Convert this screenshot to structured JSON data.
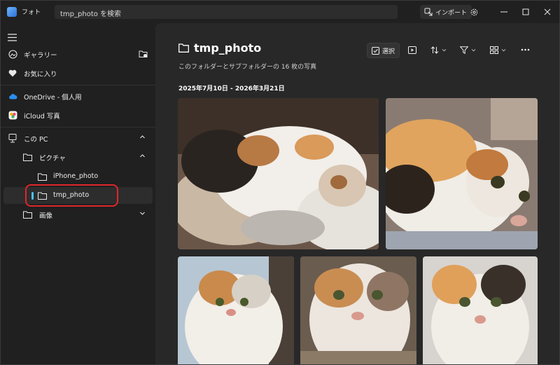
{
  "app": {
    "title": "フォト"
  },
  "search": {
    "value": "tmp_photo を検索"
  },
  "titlebar": {
    "import_label": "インポート"
  },
  "sidebar": {
    "gallery": "ギャラリー",
    "favorites": "お気に入り",
    "onedrive": "OneDrive - 個人用",
    "icloud": "iCloud 写真",
    "this_pc": "この PC",
    "pictures": "ピクチャ",
    "iphone_photo": "iPhone_photo",
    "tmp_photo": "tmp_photo",
    "images": "画像"
  },
  "main": {
    "folder_name": "tmp_photo",
    "subtitle": "このフォルダーとサブフォルダーの 16 枚の写真",
    "date_range": "2025年7月10日 - 2026年3月21日",
    "toolbar": {
      "select_label": "選択"
    }
  },
  "colors": {
    "accent": "#4cc2ff",
    "highlight_ring": "#e0262a",
    "background": "#202020",
    "content": "#282828"
  },
  "icons": [
    "app-icon",
    "import-icon",
    "gear-icon",
    "minimize-icon",
    "maximize-icon",
    "close-icon",
    "menu-icon",
    "gallery-icon",
    "add-folder-icon",
    "heart-icon",
    "onedrive-icon",
    "icloud-icon",
    "pc-icon",
    "folder-icon",
    "chevron-up-icon",
    "chevron-down-icon",
    "checkbox-icon",
    "slideshow-icon",
    "sort-icon",
    "filter-icon",
    "view-icon",
    "more-icon"
  ]
}
